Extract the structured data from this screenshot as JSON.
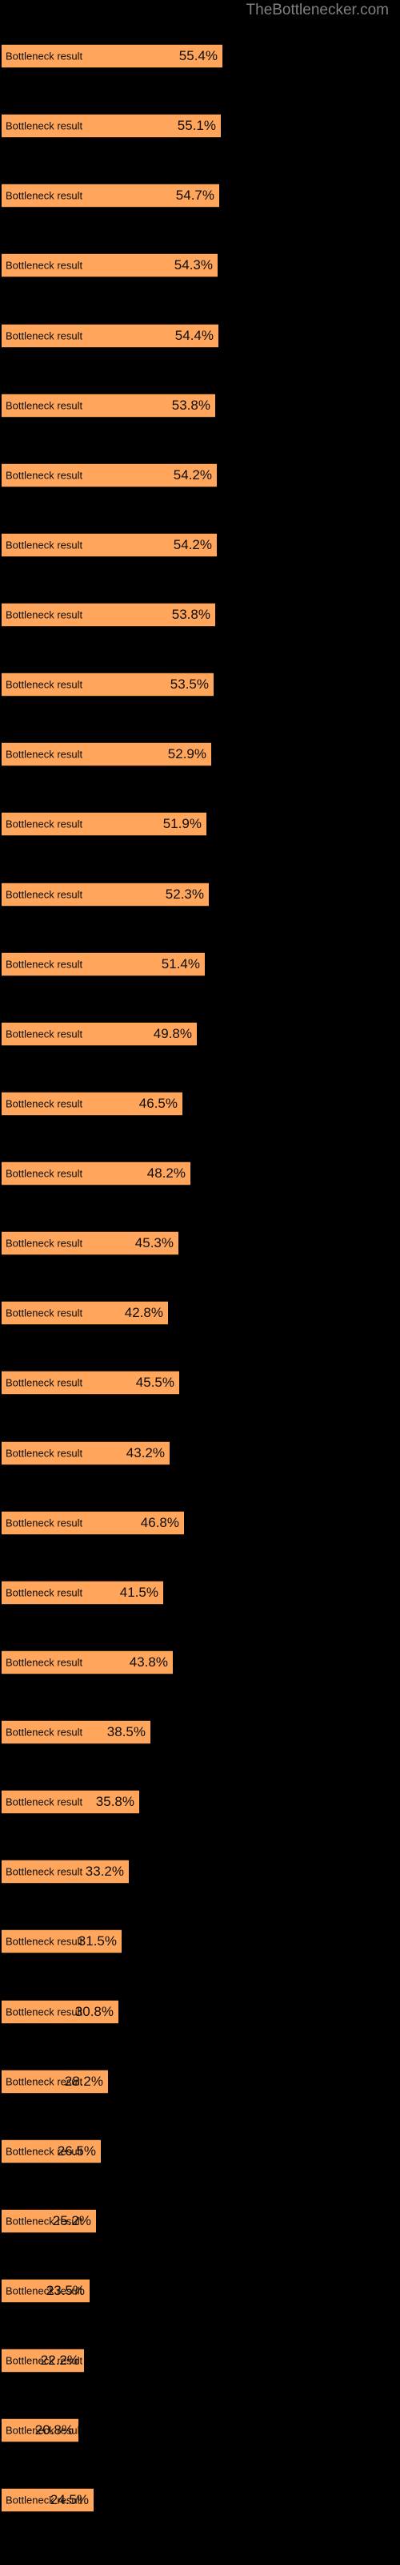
{
  "watermark": "TheBottlenecker.com",
  "chart_data": {
    "type": "bar",
    "orientation": "horizontal",
    "title": "",
    "subtitle": "",
    "xlabel": "",
    "ylabel": "",
    "grid": false,
    "legend": false,
    "bar_color": "#ffa65c",
    "bar_edge_color": "#3a2416",
    "background_color": "#000000",
    "text_color": "#0d0d0d",
    "watermark_color": "#808080",
    "value_suffix": "%",
    "xlim": [
      0,
      100
    ],
    "categories": [
      "Bottleneck result",
      "Bottleneck result",
      "Bottleneck result",
      "Bottleneck result",
      "Bottleneck result",
      "Bottleneck result",
      "Bottleneck result",
      "Bottleneck result",
      "Bottleneck result",
      "Bottleneck result",
      "Bottleneck result",
      "Bottleneck result",
      "Bottleneck result",
      "Bottleneck result",
      "Bottleneck result",
      "Bottleneck result",
      "Bottleneck result",
      "Bottleneck result",
      "Bottleneck result",
      "Bottleneck result",
      "Bottleneck result",
      "Bottleneck result",
      "Bottleneck result",
      "Bottleneck result",
      "Bottleneck result",
      "Bottleneck result",
      "Bottleneck result",
      "Bottleneck result",
      "Bottleneck result",
      "Bottleneck result",
      "Bottleneck result",
      "Bottleneck result",
      "Bottleneck result",
      "Bottleneck result",
      "Bottleneck result",
      "Bottleneck result"
    ],
    "values": [
      55.4,
      55.1,
      54.7,
      54.3,
      54.4,
      53.8,
      54.2,
      54.2,
      53.8,
      53.5,
      52.9,
      51.9,
      52.3,
      51.4,
      49.8,
      46.5,
      48.2,
      45.3,
      42.8,
      45.5,
      43.2,
      46.8,
      41.5,
      43.8,
      38.5,
      35.8,
      33.2,
      31.5,
      30.8,
      28.2,
      26.5,
      25.2,
      23.5,
      22.2,
      20.8,
      24.5
    ],
    "labels": [
      "55.4%",
      "55.1%",
      "54.7%",
      "54.3%",
      "54.4%",
      "53.8%",
      "54.2%",
      "54.2%",
      "53.8%",
      "53.5%",
      "52.9%",
      "51.9%",
      "52.3%",
      "51.4%",
      "49.8%",
      "46.5%",
      "48.2%",
      "45.3%",
      "42.8%",
      "45.5%",
      "43.2%",
      "46.8%",
      "41.5%",
      "43.8%",
      "38.5%",
      "35.8%",
      "33.2%",
      "31.5%",
      "30.8%",
      "28.2%",
      "26.5%",
      "25.2%",
      "23.5%",
      "22.2%",
      "20.8%",
      "24.5%"
    ],
    "bar_pixel_widths": [
      276,
      274,
      272,
      270,
      271,
      267,
      269,
      269,
      267,
      265,
      262,
      256,
      259,
      254,
      244,
      226,
      236,
      221,
      208,
      222,
      210,
      228,
      202,
      214,
      186,
      172,
      159,
      150,
      146,
      133,
      124,
      118,
      110,
      103,
      96,
      115
    ]
  }
}
